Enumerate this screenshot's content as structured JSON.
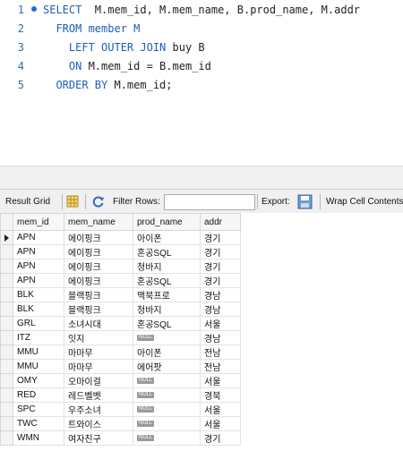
{
  "editor": {
    "lines": [
      {
        "num": "1",
        "segments": [
          {
            "t": "SELECT",
            "c": "kw"
          },
          {
            "t": "  M.mem_id, M.mem_name, B.prod_name, M.addr",
            "c": "id"
          }
        ]
      },
      {
        "num": "2",
        "segments": [
          {
            "t": "  ",
            "c": "id"
          },
          {
            "t": "FROM",
            "c": "kw"
          },
          {
            "t": " member M",
            "c": "kw"
          }
        ]
      },
      {
        "num": "3",
        "segments": [
          {
            "t": "    ",
            "c": "id"
          },
          {
            "t": "LEFT OUTER JOIN",
            "c": "kw"
          },
          {
            "t": " buy B",
            "c": "id"
          }
        ]
      },
      {
        "num": "4",
        "segments": [
          {
            "t": "    ",
            "c": "id"
          },
          {
            "t": "ON",
            "c": "kw"
          },
          {
            "t": " M.mem_id = B.mem_id",
            "c": "id"
          }
        ]
      },
      {
        "num": "5",
        "segments": [
          {
            "t": "  ",
            "c": "id"
          },
          {
            "t": "ORDER BY",
            "c": "kw"
          },
          {
            "t": " M.mem_id;",
            "c": "id"
          }
        ]
      }
    ]
  },
  "toolbar": {
    "result_grid": "Result Grid",
    "filter_rows": "Filter Rows:",
    "filter_value": "",
    "export": "Export:",
    "wrap": "Wrap Cell Contents:"
  },
  "grid": {
    "columns": [
      "mem_id",
      "mem_name",
      "prod_name",
      "addr"
    ],
    "null_label": "NULL",
    "rows": [
      [
        "APN",
        "에이핑크",
        "아이폰",
        "경기"
      ],
      [
        "APN",
        "에이핑크",
        "혼공SQL",
        "경기"
      ],
      [
        "APN",
        "에이핑크",
        "청바지",
        "경기"
      ],
      [
        "APN",
        "에이핑크",
        "혼공SQL",
        "경기"
      ],
      [
        "BLK",
        "블랙핑크",
        "맥북프로",
        "경남"
      ],
      [
        "BLK",
        "블랙핑크",
        "청바지",
        "경남"
      ],
      [
        "GRL",
        "소녀시대",
        "혼공SQL",
        "서울"
      ],
      [
        "ITZ",
        "잇지",
        null,
        "경남"
      ],
      [
        "MMU",
        "마마무",
        "아이폰",
        "전남"
      ],
      [
        "MMU",
        "마마무",
        "에어팟",
        "전남"
      ],
      [
        "OMY",
        "오마이걸",
        null,
        "서울"
      ],
      [
        "RED",
        "레드벨벳",
        null,
        "경북"
      ],
      [
        "SPC",
        "우주소녀",
        null,
        "서울"
      ],
      [
        "TWC",
        "트와이스",
        null,
        "서울"
      ],
      [
        "WMN",
        "여자친구",
        null,
        "경기"
      ]
    ]
  }
}
